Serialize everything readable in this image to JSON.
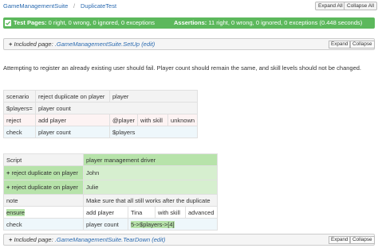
{
  "breadcrumb": {
    "root": "GameManagementSuite",
    "separator": "/",
    "current": "DuplicateTest"
  },
  "toolbar": {
    "expand_all": "Expand All",
    "collapse_all": "Collapse All"
  },
  "summary": {
    "status_color": "#5cb85c",
    "test_pages_label": "Test Pages:",
    "test_pages_value": "0 right, 0 wrong, 0 ignored, 0 exceptions",
    "assertions_label": "Assertions:",
    "assertions_value": "11 right, 0 wrong, 0 ignored, 0 exceptions (0.448 seconds)"
  },
  "setup": {
    "prefix": "+",
    "label": "Included page: ",
    "page": ".GameManagementSuite.SetUp",
    "edit": "(edit)",
    "expand": "Expand",
    "collapse": "Collapse"
  },
  "description": "Attempting to register an already existing user should fail. Player count should remain the same, and skill levels should not be changed.",
  "scenario_table": {
    "rows": [
      [
        "scenario",
        "reject duplicate on player",
        "player",
        "",
        "",
        ""
      ],
      [
        "$players=",
        "player count",
        "",
        "",
        "",
        ""
      ],
      [
        "reject",
        "add player",
        "",
        "@player",
        "with skill",
        "unknown"
      ],
      [
        "check",
        "player count",
        "",
        "$players",
        "",
        ""
      ]
    ]
  },
  "script_table": {
    "header": [
      "Script",
      "player management driver"
    ],
    "reject_rows": [
      {
        "prefix": "+",
        "label": "reject duplicate on player",
        "value": "John"
      },
      {
        "prefix": "+",
        "label": "reject duplicate on player",
        "value": "Julie"
      }
    ],
    "note_row": [
      "note",
      "Make sure that all still works after the duplicate"
    ],
    "ensure_row": [
      "ensure",
      "add player",
      "Tina",
      "with skill",
      "advanced"
    ],
    "check_row": [
      "check",
      "player count",
      "5->$players->[4]"
    ]
  },
  "teardown": {
    "prefix": "+",
    "label": "Included page: ",
    "page": ".GameManagementSuite.TearDown",
    "edit": "(edit)",
    "expand": "Expand",
    "collapse": "Collapse"
  }
}
